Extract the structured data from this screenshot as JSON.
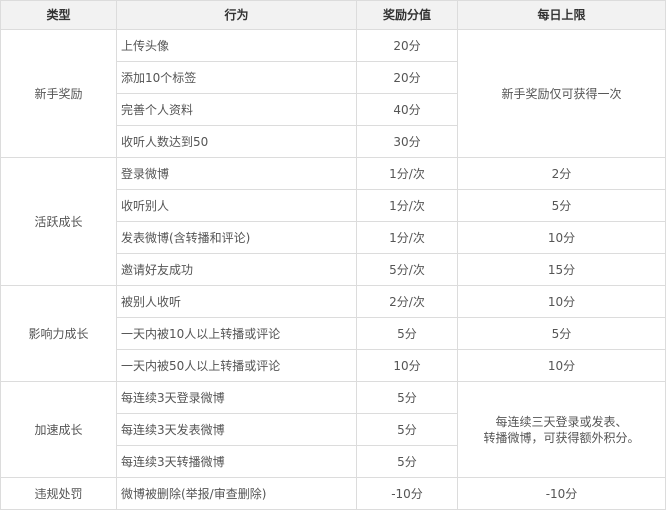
{
  "table": {
    "headers": {
      "category": "类型",
      "action": "行为",
      "points": "奖励分值",
      "daily_limit": "每日上限"
    },
    "groups": [
      {
        "category": "新手奖励",
        "shared_limit": "新手奖励仅可获得一次",
        "rows": [
          {
            "action": "上传头像",
            "points": "20分"
          },
          {
            "action": "添加10个标签",
            "points": "20分"
          },
          {
            "action": "完善个人资料",
            "points": "40分"
          },
          {
            "action": "收听人数达到50",
            "points": "30分"
          }
        ]
      },
      {
        "category": "活跃成长",
        "rows": [
          {
            "action": "登录微博",
            "points": "1分/次",
            "daily_limit": "2分"
          },
          {
            "action": "收听别人",
            "points": "1分/次",
            "daily_limit": "5分"
          },
          {
            "action": "发表微博(含转播和评论)",
            "points": "1分/次",
            "daily_limit": "10分"
          },
          {
            "action": "邀请好友成功",
            "points": "5分/次",
            "daily_limit": "15分"
          }
        ]
      },
      {
        "category": "影响力成长",
        "rows": [
          {
            "action": "被别人收听",
            "points": "2分/次",
            "daily_limit": "10分"
          },
          {
            "action": "一天内被10人以上转播或评论",
            "points": "5分",
            "daily_limit": "5分"
          },
          {
            "action": "一天内被50人以上转播或评论",
            "points": "10分",
            "daily_limit": "10分"
          }
        ]
      },
      {
        "category": "加速成长",
        "shared_limit_line1": "每连续三天登录或发表、",
        "shared_limit_line2": "转播微博，可获得额外积分。",
        "rows": [
          {
            "action": "每连续3天登录微博",
            "points": "5分"
          },
          {
            "action": "每连续3天发表微博",
            "points": "5分"
          },
          {
            "action": "每连续3天转播微博",
            "points": "5分"
          }
        ]
      },
      {
        "category": "违规处罚",
        "rows": [
          {
            "action": "微博被删除(举报/审查删除)",
            "points": "-10分",
            "daily_limit": "-10分"
          }
        ]
      }
    ]
  }
}
